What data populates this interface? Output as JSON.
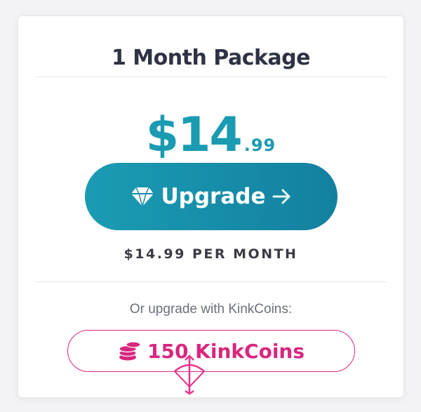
{
  "package": {
    "title": "1 Month Package",
    "price_main": "$14",
    "price_cents": ".99",
    "upgrade_label": "Upgrade",
    "billing_text": "$14.99 PER MONTH",
    "coins_prompt": "Or upgrade with KinkCoins:",
    "coins_label": "150 KinkCoins"
  },
  "colors": {
    "price": "#1a9bb2",
    "button": "#1b9cb3",
    "coins": "#d8277f"
  },
  "icons": {
    "upgrade_left": "diamond-icon",
    "upgrade_right": "arrow-right-icon",
    "coins": "coin-stack-icon",
    "watermark": "bow-arrow-logo-icon"
  }
}
